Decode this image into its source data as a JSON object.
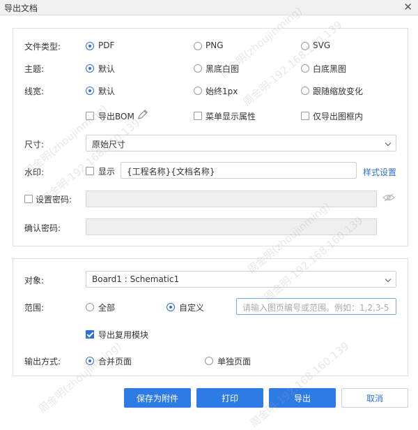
{
  "window": {
    "title": "导出文档"
  },
  "file_type": {
    "label": "文件类型:",
    "options": [
      "PDF",
      "PNG",
      "SVG"
    ],
    "selected": "PDF"
  },
  "theme": {
    "label": "主题:",
    "options": [
      "默认",
      "黑底白图",
      "白底黑图"
    ],
    "selected": "默认"
  },
  "line_width": {
    "label": "线宽:",
    "options": [
      "默认",
      "始终1px",
      "跟随缩放变化"
    ],
    "selected": "默认"
  },
  "checks": {
    "export_bom": "导出BOM",
    "menu_attrs": "菜单显示属性",
    "frame_only": "仅导出图框内"
  },
  "size": {
    "label": "尺寸:",
    "value": "原始尺寸"
  },
  "watermark": {
    "label": "水印:",
    "show_label": "显示",
    "text": "{工程名称}{文档名称}",
    "style_link": "样式设置"
  },
  "password": {
    "set_label": "设置密码:",
    "confirm_label": "确认密码:"
  },
  "object": {
    "label": "对象:",
    "value": "Board1 : Schematic1"
  },
  "range": {
    "label": "范围:",
    "options": [
      "全部",
      "自定义"
    ],
    "selected": "自定义",
    "placeholder": "请输入图页编号或范围。例如：1,2,3-5"
  },
  "reuse": {
    "label": "导出复用模块",
    "checked": true
  },
  "output_mode": {
    "label": "输出方式:",
    "options": [
      "合并页面",
      "单独页面"
    ],
    "selected": "合并页面"
  },
  "buttons": {
    "save_attachment": "保存为附件",
    "print": "打印",
    "export": "导出",
    "cancel": "取消"
  },
  "watermark_overlay": [
    "周金明(zhoujinming)",
    "周金明-192.168.160.139"
  ]
}
